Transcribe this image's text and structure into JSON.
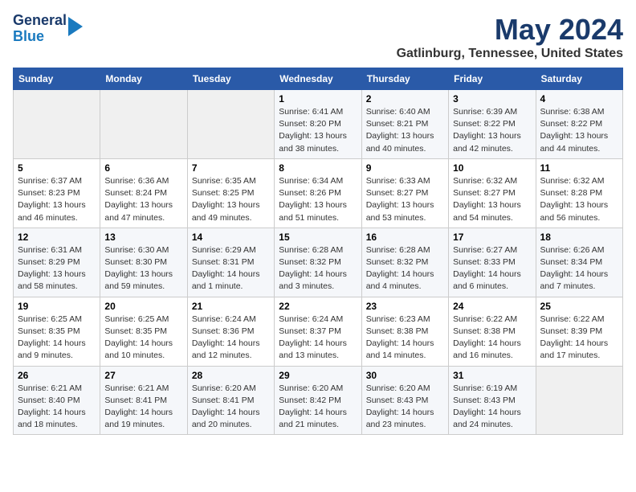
{
  "header": {
    "logo_line1": "General",
    "logo_line2": "Blue",
    "month_year": "May 2024",
    "location": "Gatlinburg, Tennessee, United States"
  },
  "weekdays": [
    "Sunday",
    "Monday",
    "Tuesday",
    "Wednesday",
    "Thursday",
    "Friday",
    "Saturday"
  ],
  "weeks": [
    [
      {
        "day": "",
        "sunrise": "",
        "sunset": "",
        "daylight": ""
      },
      {
        "day": "",
        "sunrise": "",
        "sunset": "",
        "daylight": ""
      },
      {
        "day": "",
        "sunrise": "",
        "sunset": "",
        "daylight": ""
      },
      {
        "day": "1",
        "sunrise": "Sunrise: 6:41 AM",
        "sunset": "Sunset: 8:20 PM",
        "daylight": "Daylight: 13 hours and 38 minutes."
      },
      {
        "day": "2",
        "sunrise": "Sunrise: 6:40 AM",
        "sunset": "Sunset: 8:21 PM",
        "daylight": "Daylight: 13 hours and 40 minutes."
      },
      {
        "day": "3",
        "sunrise": "Sunrise: 6:39 AM",
        "sunset": "Sunset: 8:22 PM",
        "daylight": "Daylight: 13 hours and 42 minutes."
      },
      {
        "day": "4",
        "sunrise": "Sunrise: 6:38 AM",
        "sunset": "Sunset: 8:22 PM",
        "daylight": "Daylight: 13 hours and 44 minutes."
      }
    ],
    [
      {
        "day": "5",
        "sunrise": "Sunrise: 6:37 AM",
        "sunset": "Sunset: 8:23 PM",
        "daylight": "Daylight: 13 hours and 46 minutes."
      },
      {
        "day": "6",
        "sunrise": "Sunrise: 6:36 AM",
        "sunset": "Sunset: 8:24 PM",
        "daylight": "Daylight: 13 hours and 47 minutes."
      },
      {
        "day": "7",
        "sunrise": "Sunrise: 6:35 AM",
        "sunset": "Sunset: 8:25 PM",
        "daylight": "Daylight: 13 hours and 49 minutes."
      },
      {
        "day": "8",
        "sunrise": "Sunrise: 6:34 AM",
        "sunset": "Sunset: 8:26 PM",
        "daylight": "Daylight: 13 hours and 51 minutes."
      },
      {
        "day": "9",
        "sunrise": "Sunrise: 6:33 AM",
        "sunset": "Sunset: 8:27 PM",
        "daylight": "Daylight: 13 hours and 53 minutes."
      },
      {
        "day": "10",
        "sunrise": "Sunrise: 6:32 AM",
        "sunset": "Sunset: 8:27 PM",
        "daylight": "Daylight: 13 hours and 54 minutes."
      },
      {
        "day": "11",
        "sunrise": "Sunrise: 6:32 AM",
        "sunset": "Sunset: 8:28 PM",
        "daylight": "Daylight: 13 hours and 56 minutes."
      }
    ],
    [
      {
        "day": "12",
        "sunrise": "Sunrise: 6:31 AM",
        "sunset": "Sunset: 8:29 PM",
        "daylight": "Daylight: 13 hours and 58 minutes."
      },
      {
        "day": "13",
        "sunrise": "Sunrise: 6:30 AM",
        "sunset": "Sunset: 8:30 PM",
        "daylight": "Daylight: 13 hours and 59 minutes."
      },
      {
        "day": "14",
        "sunrise": "Sunrise: 6:29 AM",
        "sunset": "Sunset: 8:31 PM",
        "daylight": "Daylight: 14 hours and 1 minute."
      },
      {
        "day": "15",
        "sunrise": "Sunrise: 6:28 AM",
        "sunset": "Sunset: 8:32 PM",
        "daylight": "Daylight: 14 hours and 3 minutes."
      },
      {
        "day": "16",
        "sunrise": "Sunrise: 6:28 AM",
        "sunset": "Sunset: 8:32 PM",
        "daylight": "Daylight: 14 hours and 4 minutes."
      },
      {
        "day": "17",
        "sunrise": "Sunrise: 6:27 AM",
        "sunset": "Sunset: 8:33 PM",
        "daylight": "Daylight: 14 hours and 6 minutes."
      },
      {
        "day": "18",
        "sunrise": "Sunrise: 6:26 AM",
        "sunset": "Sunset: 8:34 PM",
        "daylight": "Daylight: 14 hours and 7 minutes."
      }
    ],
    [
      {
        "day": "19",
        "sunrise": "Sunrise: 6:25 AM",
        "sunset": "Sunset: 8:35 PM",
        "daylight": "Daylight: 14 hours and 9 minutes."
      },
      {
        "day": "20",
        "sunrise": "Sunrise: 6:25 AM",
        "sunset": "Sunset: 8:35 PM",
        "daylight": "Daylight: 14 hours and 10 minutes."
      },
      {
        "day": "21",
        "sunrise": "Sunrise: 6:24 AM",
        "sunset": "Sunset: 8:36 PM",
        "daylight": "Daylight: 14 hours and 12 minutes."
      },
      {
        "day": "22",
        "sunrise": "Sunrise: 6:24 AM",
        "sunset": "Sunset: 8:37 PM",
        "daylight": "Daylight: 14 hours and 13 minutes."
      },
      {
        "day": "23",
        "sunrise": "Sunrise: 6:23 AM",
        "sunset": "Sunset: 8:38 PM",
        "daylight": "Daylight: 14 hours and 14 minutes."
      },
      {
        "day": "24",
        "sunrise": "Sunrise: 6:22 AM",
        "sunset": "Sunset: 8:38 PM",
        "daylight": "Daylight: 14 hours and 16 minutes."
      },
      {
        "day": "25",
        "sunrise": "Sunrise: 6:22 AM",
        "sunset": "Sunset: 8:39 PM",
        "daylight": "Daylight: 14 hours and 17 minutes."
      }
    ],
    [
      {
        "day": "26",
        "sunrise": "Sunrise: 6:21 AM",
        "sunset": "Sunset: 8:40 PM",
        "daylight": "Daylight: 14 hours and 18 minutes."
      },
      {
        "day": "27",
        "sunrise": "Sunrise: 6:21 AM",
        "sunset": "Sunset: 8:41 PM",
        "daylight": "Daylight: 14 hours and 19 minutes."
      },
      {
        "day": "28",
        "sunrise": "Sunrise: 6:20 AM",
        "sunset": "Sunset: 8:41 PM",
        "daylight": "Daylight: 14 hours and 20 minutes."
      },
      {
        "day": "29",
        "sunrise": "Sunrise: 6:20 AM",
        "sunset": "Sunset: 8:42 PM",
        "daylight": "Daylight: 14 hours and 21 minutes."
      },
      {
        "day": "30",
        "sunrise": "Sunrise: 6:20 AM",
        "sunset": "Sunset: 8:43 PM",
        "daylight": "Daylight: 14 hours and 23 minutes."
      },
      {
        "day": "31",
        "sunrise": "Sunrise: 6:19 AM",
        "sunset": "Sunset: 8:43 PM",
        "daylight": "Daylight: 14 hours and 24 minutes."
      },
      {
        "day": "",
        "sunrise": "",
        "sunset": "",
        "daylight": ""
      }
    ]
  ]
}
